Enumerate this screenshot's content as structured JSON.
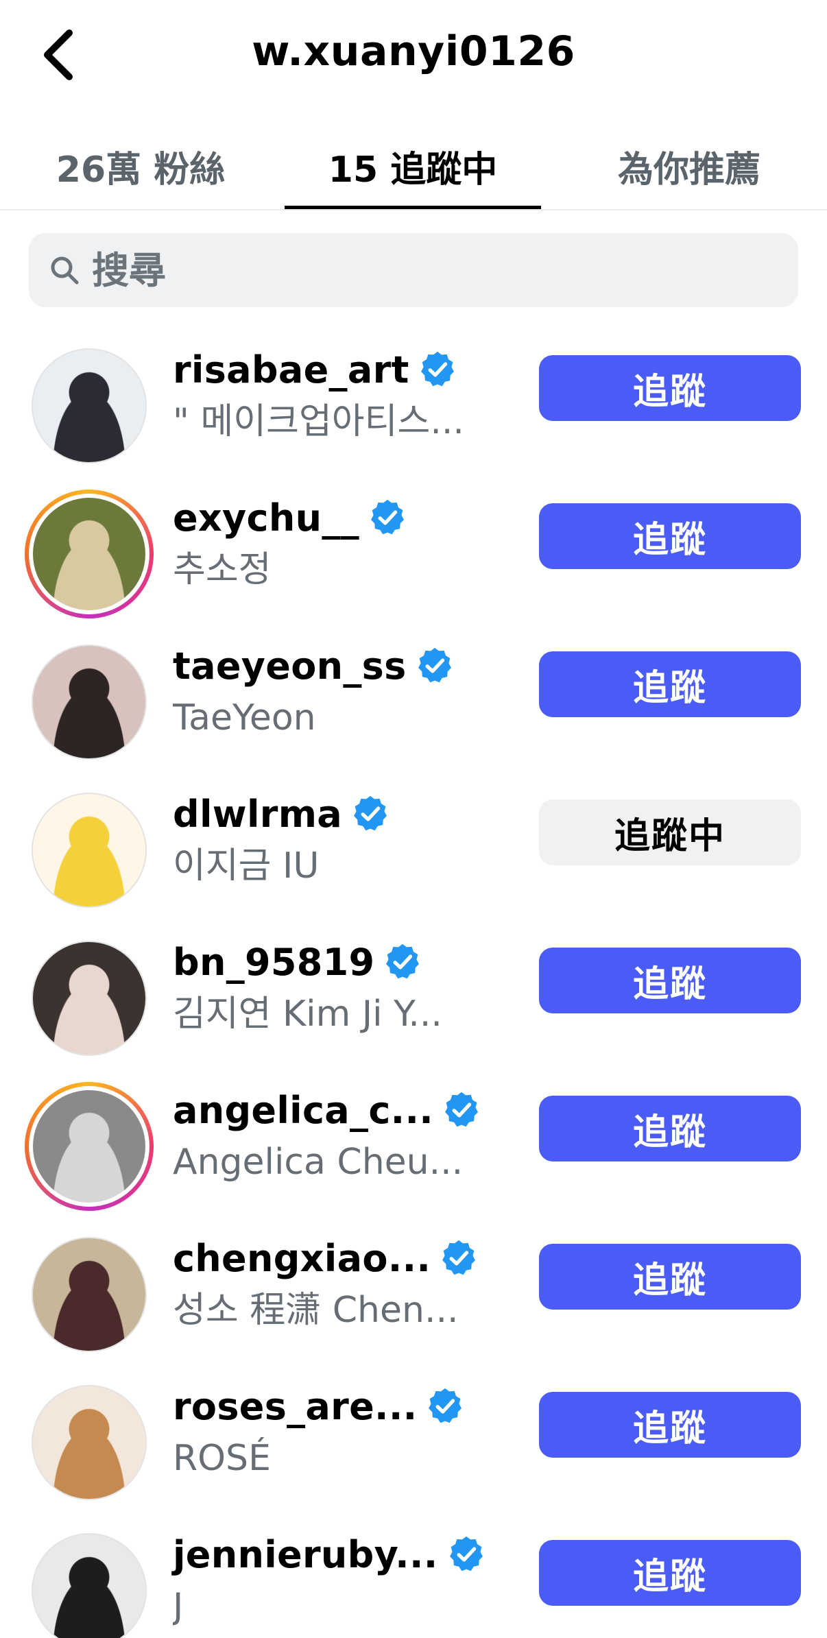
{
  "header": {
    "title": "w.xuanyi0126"
  },
  "tabs": [
    {
      "label": "26萬 粉絲",
      "active": false
    },
    {
      "label": "15 追蹤中",
      "active": true
    },
    {
      "label": "為你推薦",
      "active": false
    }
  ],
  "search": {
    "placeholder": "搜尋"
  },
  "colors": {
    "accent": "#4a5cf5",
    "verified": "#2196f3",
    "secondary_button": "#eff1f3"
  },
  "users": [
    {
      "username": "risabae_art",
      "name": "\" 메이크업아티스...",
      "verified": true,
      "story": false,
      "button": "追蹤",
      "following": false
    },
    {
      "username": "exychu__",
      "name": "추소정",
      "verified": true,
      "story": true,
      "button": "追蹤",
      "following": false
    },
    {
      "username": "taeyeon_ss",
      "name": "TaeYeon",
      "verified": true,
      "story": false,
      "button": "追蹤",
      "following": false
    },
    {
      "username": "dlwlrma",
      "name": "이지금 IU",
      "verified": true,
      "story": false,
      "button": "追蹤中",
      "following": true
    },
    {
      "username": "bn_95819",
      "name": "김지연 Kim Ji Y...",
      "verified": true,
      "story": false,
      "button": "追蹤",
      "following": false
    },
    {
      "username": "angelica_c...",
      "name": "Angelica Cheu...",
      "verified": true,
      "story": true,
      "button": "追蹤",
      "following": false
    },
    {
      "username": "chengxiao...",
      "name": "성소 程潇 Chen...",
      "verified": true,
      "story": false,
      "button": "追蹤",
      "following": false
    },
    {
      "username": "roses_are...",
      "name": "ROSÉ",
      "verified": true,
      "story": false,
      "button": "追蹤",
      "following": false
    },
    {
      "username": "jennieruby...",
      "name": "J",
      "verified": true,
      "story": false,
      "button": "追蹤",
      "following": false
    }
  ]
}
